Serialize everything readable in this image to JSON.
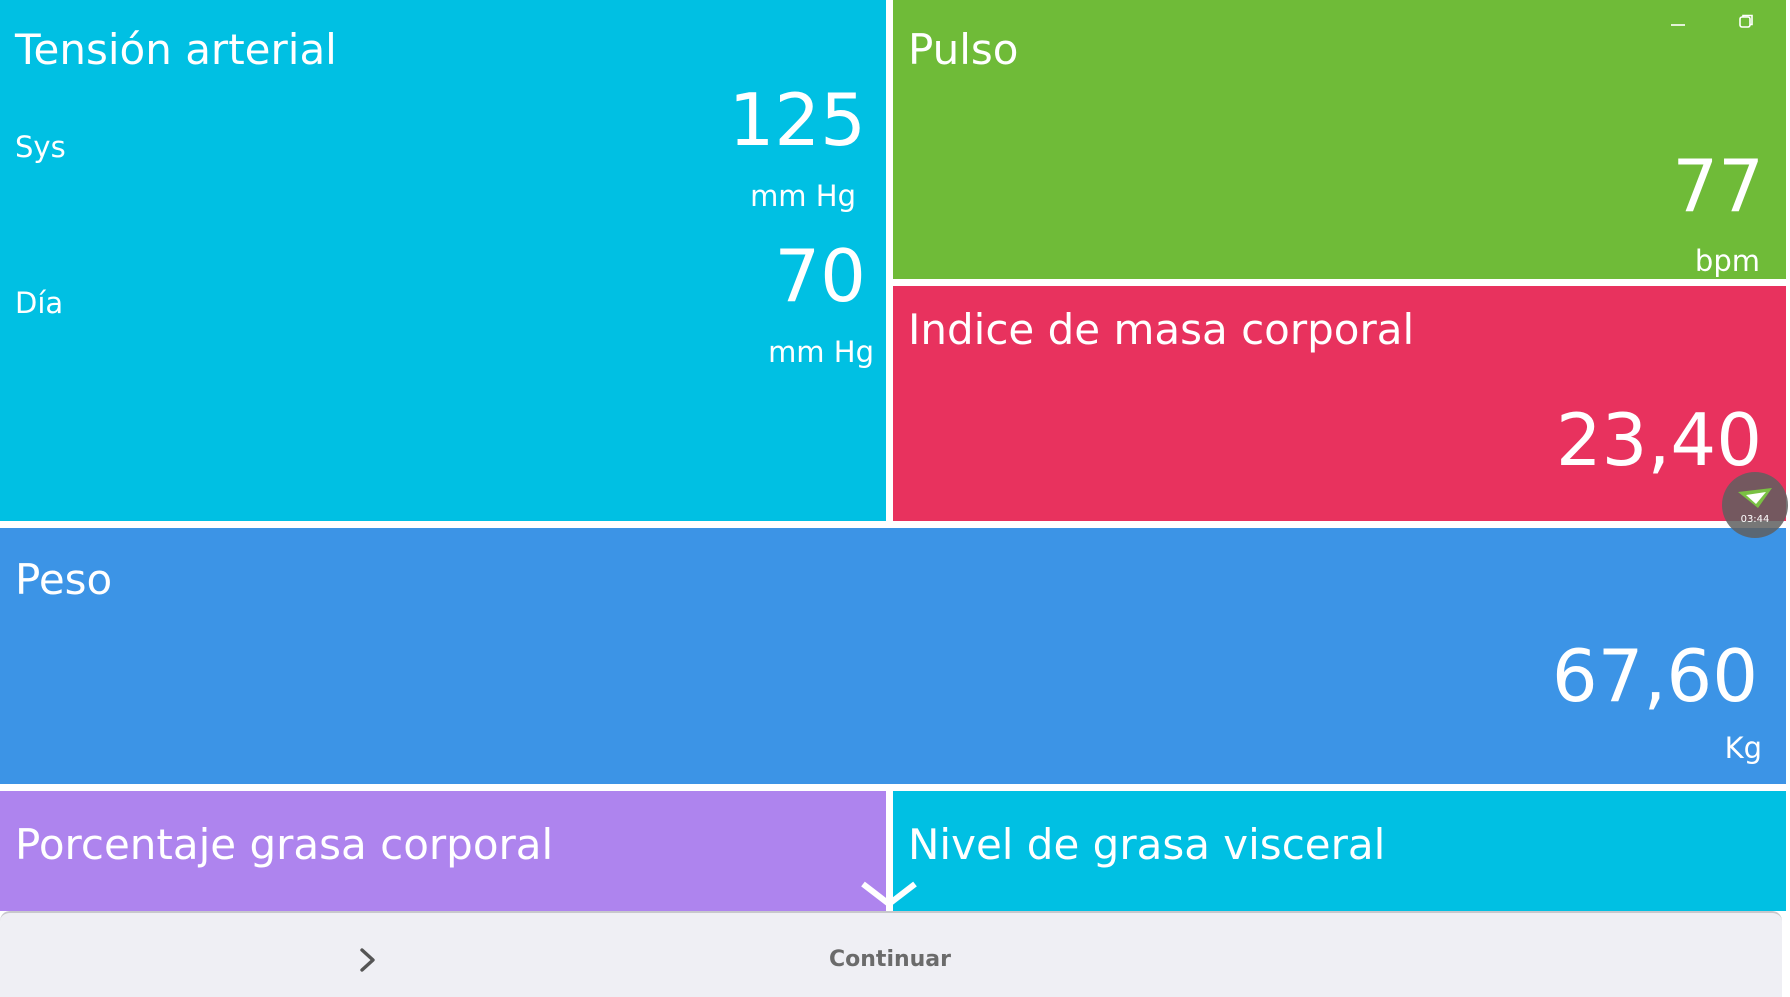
{
  "window": {
    "minimize_icon": "minimize-icon",
    "restore_icon": "restore-icon"
  },
  "colors": {
    "cyan": "#00c0e3",
    "green": "#6fbb38",
    "red": "#e8325e",
    "blue": "#3c94e6",
    "purple": "#ae84ee",
    "bar": "#efeff4"
  },
  "blood_pressure": {
    "title": "Tensión arterial",
    "sys_label": "Sys",
    "sys_value": "125",
    "sys_unit": "mm Hg",
    "dia_label": "Día",
    "dia_value": "70",
    "dia_unit": "mm Hg"
  },
  "pulse": {
    "title": "Pulso",
    "value": "77",
    "unit": "bpm"
  },
  "bmi": {
    "title": "Indice de masa corporal",
    "value": "23,40"
  },
  "weight": {
    "title": "Peso",
    "value": "67,60",
    "unit": "Kg"
  },
  "body_fat": {
    "title": "Porcentaje grasa corporal"
  },
  "visceral_fat": {
    "title": "Nivel de grasa visceral"
  },
  "recorder": {
    "time": "03:44",
    "icon": "paper-plane-icon"
  },
  "footer": {
    "next_icon": "chevron-right-icon",
    "continue_label": "Continuar"
  }
}
